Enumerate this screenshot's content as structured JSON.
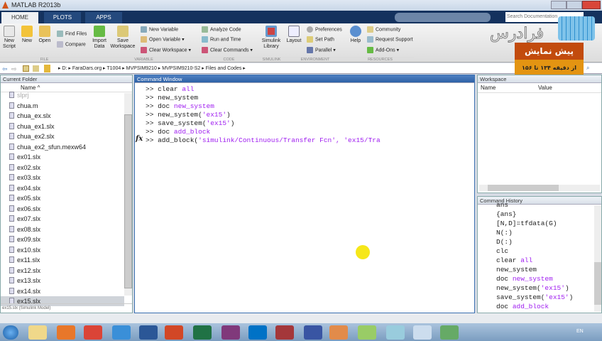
{
  "window": {
    "title": "MATLAB R2013b"
  },
  "tabs": [
    "HOME",
    "PLOTS",
    "APPS"
  ],
  "ribbon": {
    "file": {
      "new_script": "New Script",
      "new": "New",
      "open": "Open",
      "find_files": "Find Files",
      "compare": "Compare",
      "label": "FILE"
    },
    "variable": {
      "import_data": "Import Data",
      "save_workspace": "Save Workspace",
      "new_variable": "New Variable",
      "open_variable": "Open Variable",
      "clear_workspace": "Clear Workspace",
      "label": "VARIABLE"
    },
    "code": {
      "analyze_code": "Analyze Code",
      "run_and_time": "Run and Time",
      "clear_commands": "Clear Commands",
      "label": "CODE"
    },
    "simulink": {
      "library": "Simulink Library",
      "label": "SIMULINK"
    },
    "environment": {
      "layout": "Layout",
      "preferences": "Preferences",
      "set_path": "Set Path",
      "parallel": "Parallel",
      "label": "ENVIRONMENT"
    },
    "resources": {
      "help": "Help",
      "community": "Community",
      "request_support": "Request Support",
      "add_ons": "Add-Ons",
      "label": "RESOURCES"
    }
  },
  "search": {
    "placeholder": "Search Documentation"
  },
  "address": {
    "path": [
      "D:",
      "FaraDars.org",
      "T1004",
      "MVPSIM9210",
      "MVPSIM9210-S2",
      "Files and Codes"
    ]
  },
  "watermark": {
    "brand": "فرادرس",
    "preview": "پیش نمایش",
    "range": "از دقیقه ۱۳۴ تا ۱۵۶"
  },
  "current_folder": {
    "title": "Current Folder",
    "col_name": "Name",
    "files": [
      "slprj",
      "chua.m",
      "chua_ex.slx",
      "chua_ex1.slx",
      "chua_ex2.slx",
      "chua_ex2_sfun.mexw64",
      "ex01.slx",
      "ex02.slx",
      "ex03.slx",
      "ex04.slx",
      "ex05.slx",
      "ex06.slx",
      "ex07.slx",
      "ex08.slx",
      "ex09.slx",
      "ex10.slx",
      "ex11.slx",
      "ex12.slx",
      "ex13.slx",
      "ex14.slx",
      "ex15.slx"
    ],
    "details": "ex15.slx (Simulink Model)"
  },
  "command_window": {
    "title": "Command Window",
    "lines": [
      {
        "p": ">> ",
        "c": "clear ",
        "a": "all"
      },
      {
        "p": ">> ",
        "c": "new_system",
        "a": ""
      },
      {
        "p": ">> ",
        "c": "doc ",
        "a": "new_system"
      },
      {
        "p": ">> ",
        "c": "new_system(",
        "a": "'ex15'",
        "e": ")"
      },
      {
        "p": ">> ",
        "c": "save_system(",
        "a": "'ex15'",
        "e": ")"
      },
      {
        "p": ">> ",
        "c": "doc ",
        "a": "add_block"
      },
      {
        "p": ">> ",
        "c": "add_block(",
        "a": "'simulink/Continuous/Transfer Fcn', 'ex15/Tra"
      }
    ],
    "fx": "fx"
  },
  "workspace": {
    "title": "Workspace",
    "col_name": "Name",
    "col_value": "Value"
  },
  "history": {
    "title": "Command History",
    "lines": [
      {
        "c": "ans",
        "a": ""
      },
      {
        "c": "{ans}",
        "a": ""
      },
      {
        "c": "[N,D]=tfdata(G)",
        "a": ""
      },
      {
        "c": "N(:)",
        "a": ""
      },
      {
        "c": "D(:)",
        "a": ""
      },
      {
        "c": "clc",
        "a": ""
      },
      {
        "c": "clear ",
        "a": "all"
      },
      {
        "c": "new_system",
        "a": ""
      },
      {
        "c": "doc ",
        "a": "new_system"
      },
      {
        "c": "new_system(",
        "a": "'ex15'",
        "e": ")"
      },
      {
        "c": "save_system(",
        "a": "'ex15'",
        "e": ")"
      },
      {
        "c": "doc ",
        "a": "add_block"
      }
    ]
  },
  "taskbar": {
    "lang": "EN"
  }
}
